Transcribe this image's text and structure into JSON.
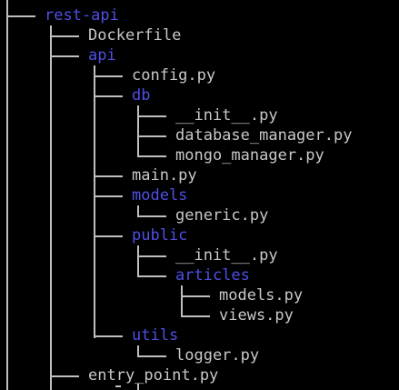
{
  "tree": {
    "root": "rest-api",
    "dockerfile": "Dockerfile",
    "api": "api",
    "config": "config.py",
    "db": "db",
    "db_init": "__init__.py",
    "database_manager": "database_manager.py",
    "mongo_manager": "mongo_manager.py",
    "main": "main.py",
    "models": "models",
    "generic": "generic.py",
    "public": "public",
    "public_init": "__init__.py",
    "articles": "articles",
    "articles_models": "models.py",
    "articles_views": "views.py",
    "utils": "utils",
    "logger": "logger.py",
    "entry_point": "entry_point.py"
  },
  "colors": {
    "file": "#c8c8c8",
    "directory": "#4f4fe6",
    "connector": "#bfbfbf",
    "background": "#000000"
  }
}
